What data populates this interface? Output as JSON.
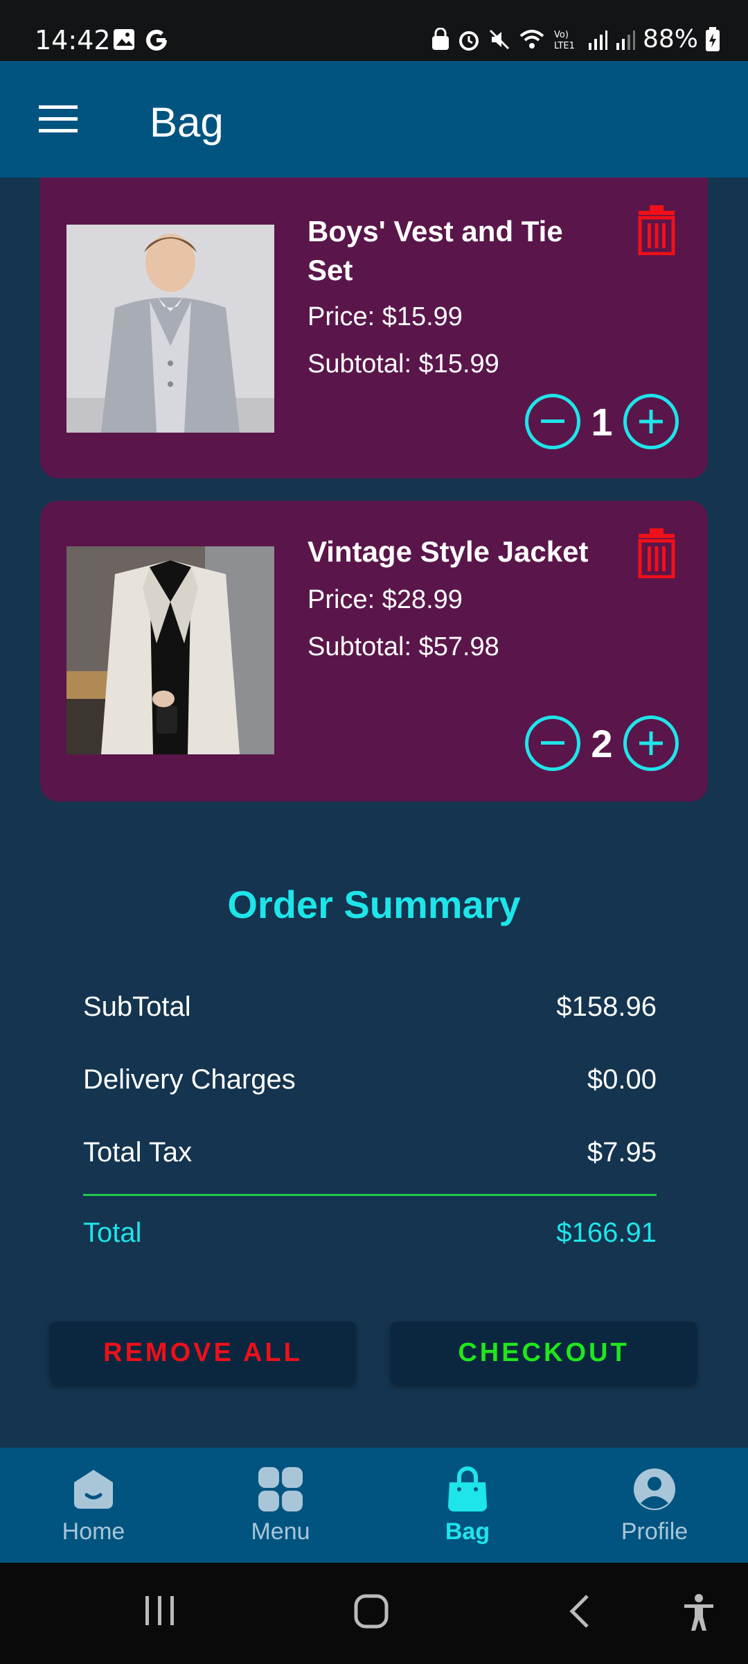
{
  "status_bar": {
    "time": "14:42",
    "battery": "88%"
  },
  "app_bar": {
    "title": "Bag"
  },
  "cart_items": [
    {
      "name": "Boys' Vest and Tie Set",
      "price": "Price: $15.99",
      "subtotal": "Subtotal: $15.99",
      "quantity": "1"
    },
    {
      "name": "Vintage Style Jacket",
      "price": "Price: $28.99",
      "subtotal": "Subtotal: $57.98",
      "quantity": "2"
    }
  ],
  "summary": {
    "title": "Order Summary",
    "rows": [
      {
        "label": "SubTotal",
        "value": "$158.96"
      },
      {
        "label": "Delivery Charges",
        "value": "$0.00"
      },
      {
        "label": "Total Tax",
        "value": "$7.95"
      }
    ],
    "total_label": "Total",
    "total_value": "$166.91"
  },
  "actions": {
    "remove_all": "REMOVE ALL",
    "checkout": "CHECKOUT"
  },
  "bottom_nav": [
    {
      "label": "Home",
      "icon": "home-icon"
    },
    {
      "label": "Menu",
      "icon": "menu-grid-icon"
    },
    {
      "label": "Bag",
      "icon": "bag-icon",
      "active": true
    },
    {
      "label": "Profile",
      "icon": "profile-icon"
    }
  ],
  "colors": {
    "accent": "#1EE5EA",
    "card": "#5A164A",
    "app_bar": "#015480",
    "danger": "#EF1019",
    "success": "#1EE81C"
  }
}
